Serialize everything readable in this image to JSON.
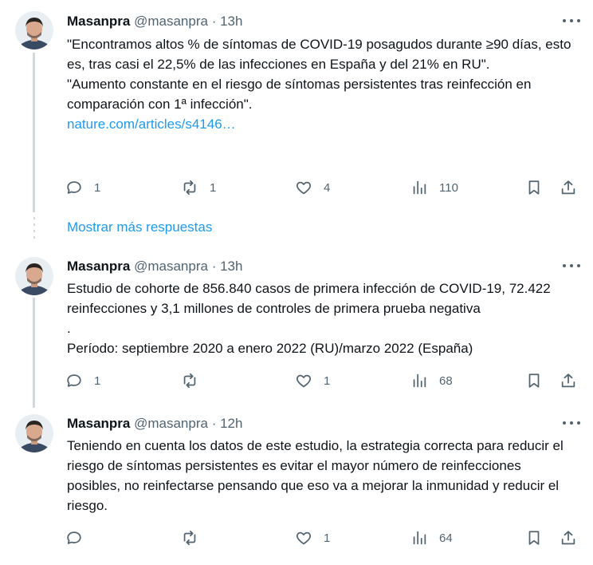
{
  "tweets": [
    {
      "name": "Masanpra",
      "handle": "@masanpra",
      "time": "13h",
      "paragraphs": [
        "\"Encontramos altos % de síntomas de COVID-19 posagudos durante ≥90 días, esto es, tras casi el 22,5% de las infecciones en España y del 21% en RU\".",
        "\"Aumento constante en el riesgo de síntomas persistentes tras reinfección en comparación con 1ª infección\"."
      ],
      "link": "nature.com/articles/s4146…",
      "replies": "1",
      "retweets": "1",
      "likes": "4",
      "views": "110"
    },
    {
      "name": "Masanpra",
      "handle": "@masanpra",
      "time": "13h",
      "paragraphs": [
        "Estudio de cohorte de 856.840 casos de primera infección de COVID-19, 72.422 reinfecciones y 3,1 millones de controles de primera prueba negativa\n.",
        "Período: septiembre 2020 a enero 2022 (RU)/marzo 2022 (España)"
      ],
      "replies": "1",
      "retweets": "",
      "likes": "1",
      "views": "68"
    },
    {
      "name": "Masanpra",
      "handle": "@masanpra",
      "time": "12h",
      "paragraphs": [
        "Teniendo en cuenta los datos de este estudio, la estrategia correcta para reducir el riesgo de síntomas persistentes es evitar el mayor número de reinfecciones posibles, no reinfectarse pensando que eso va a mejorar la inmunidad y reducir el riesgo."
      ],
      "replies": "",
      "retweets": "",
      "likes": "1",
      "views": "64"
    }
  ],
  "show_more": "Mostrar más respuestas",
  "colors": {
    "accent": "#1d9bf0",
    "muted": "#536471",
    "text": "#0f1419",
    "line": "#cfd9de"
  },
  "icons": [
    "more-icon",
    "reply-icon",
    "retweet-icon",
    "like-icon",
    "views-icon",
    "bookmark-icon",
    "share-icon"
  ]
}
